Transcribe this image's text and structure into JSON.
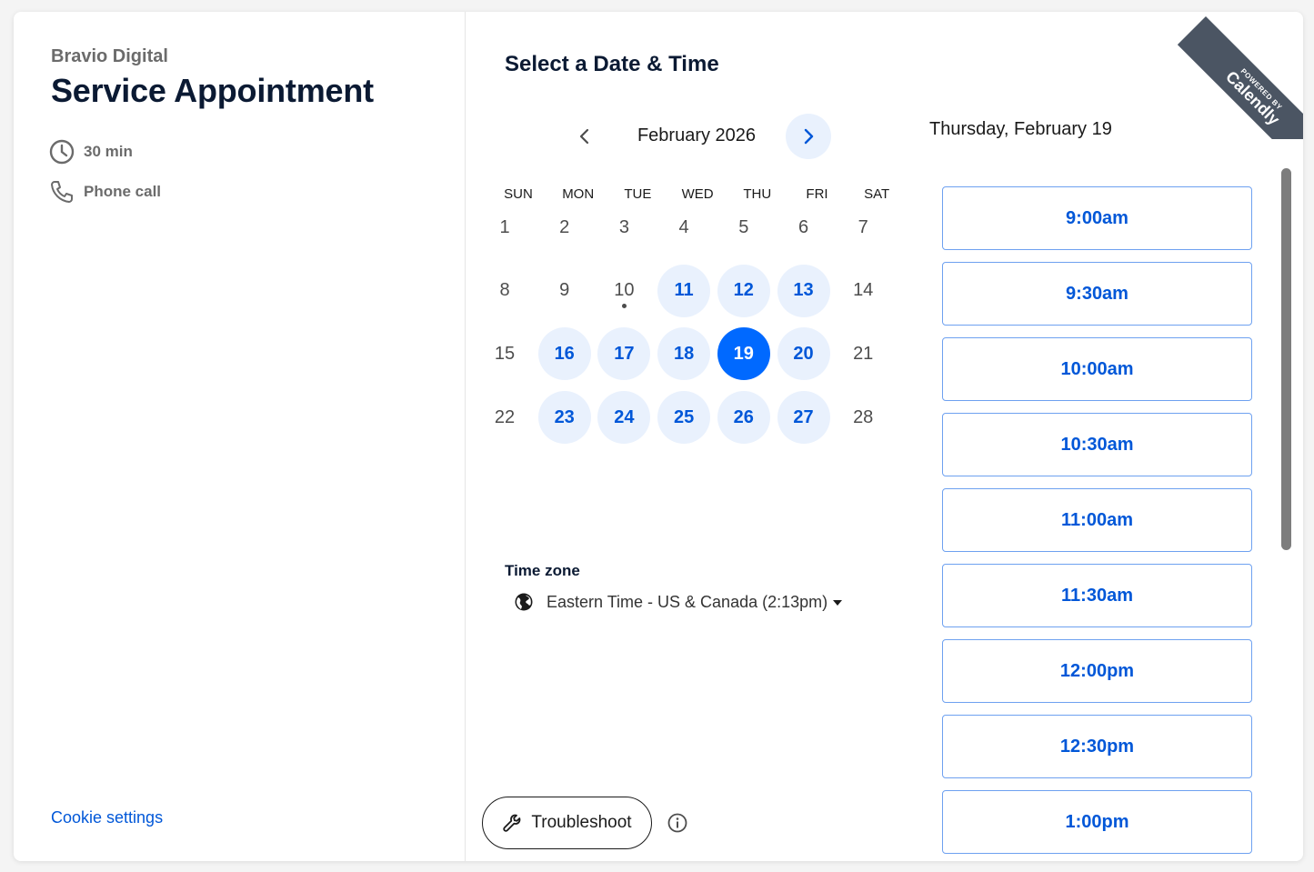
{
  "event": {
    "organization": "Bravio Digital",
    "title": "Service Appointment",
    "duration": "30 min",
    "location": "Phone call",
    "duration_icon": "clock-icon",
    "location_icon": "phone-icon"
  },
  "footer": {
    "cookie_settings": "Cookie settings",
    "troubleshoot": "Troubleshoot"
  },
  "scheduler": {
    "heading": "Select a Date & Time",
    "month": "February 2026",
    "weekdays": [
      "SUN",
      "MON",
      "TUE",
      "WED",
      "THU",
      "FRI",
      "SAT"
    ],
    "days": [
      {
        "n": "1",
        "s": "none"
      },
      {
        "n": "2",
        "s": "none"
      },
      {
        "n": "3",
        "s": "none"
      },
      {
        "n": "4",
        "s": "none"
      },
      {
        "n": "5",
        "s": "none"
      },
      {
        "n": "6",
        "s": "none"
      },
      {
        "n": "7",
        "s": "none"
      },
      {
        "n": "8",
        "s": "none"
      },
      {
        "n": "9",
        "s": "none"
      },
      {
        "n": "10",
        "s": "today"
      },
      {
        "n": "11",
        "s": "avail"
      },
      {
        "n": "12",
        "s": "avail"
      },
      {
        "n": "13",
        "s": "avail"
      },
      {
        "n": "14",
        "s": "none"
      },
      {
        "n": "15",
        "s": "none"
      },
      {
        "n": "16",
        "s": "avail"
      },
      {
        "n": "17",
        "s": "avail"
      },
      {
        "n": "18",
        "s": "avail"
      },
      {
        "n": "19",
        "s": "selected"
      },
      {
        "n": "20",
        "s": "avail"
      },
      {
        "n": "21",
        "s": "none"
      },
      {
        "n": "22",
        "s": "none"
      },
      {
        "n": "23",
        "s": "avail"
      },
      {
        "n": "24",
        "s": "avail"
      },
      {
        "n": "25",
        "s": "avail"
      },
      {
        "n": "26",
        "s": "avail"
      },
      {
        "n": "27",
        "s": "avail"
      },
      {
        "n": "28",
        "s": "none"
      }
    ],
    "timezone_label": "Time zone",
    "timezone_value": "Eastern Time - US & Canada (2:13pm)",
    "selected_date": "Thursday, February 19",
    "time_slots": [
      "9:00am",
      "9:30am",
      "10:00am",
      "10:30am",
      "11:00am",
      "11:30am",
      "12:00pm",
      "12:30pm",
      "1:00pm"
    ]
  },
  "branding": {
    "powered_by": "POWERED BY",
    "brand": "Calendly"
  },
  "colors": {
    "accent": "#0069ff",
    "link": "#0057d8",
    "available_bg": "#e9f1fd",
    "ribbon": "#4b5563"
  }
}
